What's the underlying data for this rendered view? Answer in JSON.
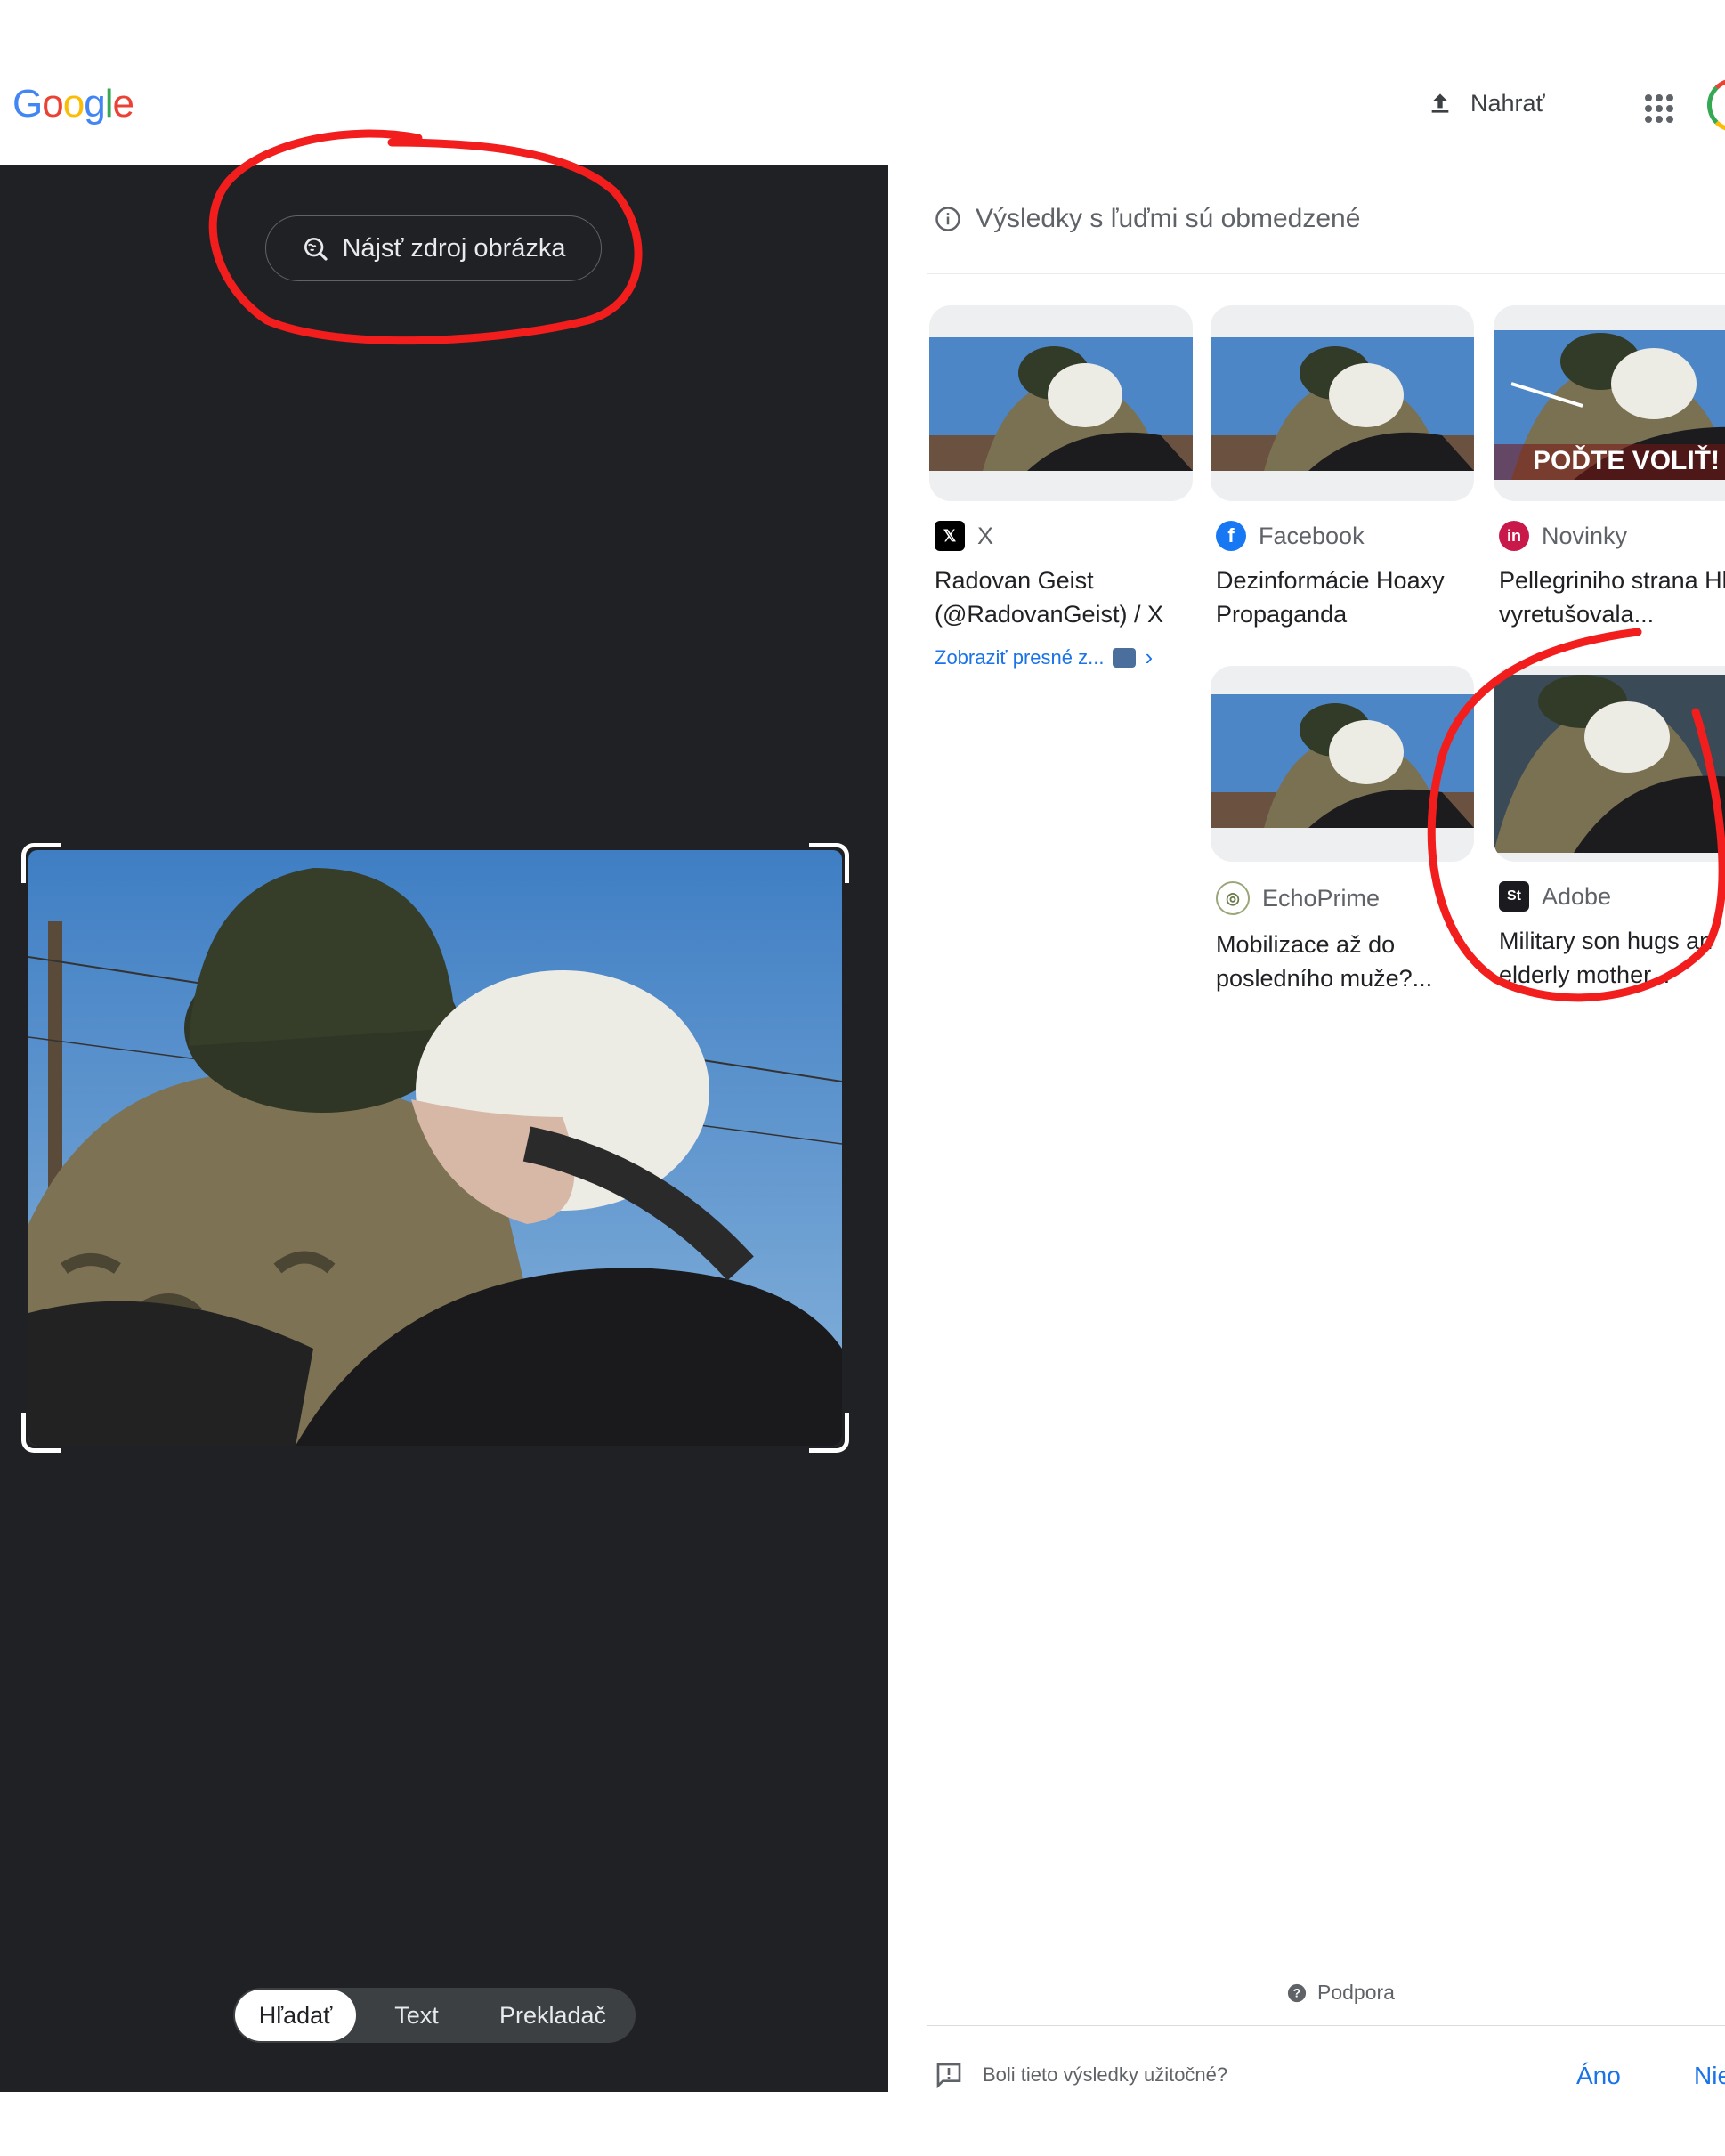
{
  "header": {
    "logo_letters": [
      "G",
      "o",
      "o",
      "g",
      "l",
      "e"
    ],
    "logo_colors": [
      "#4285f4",
      "#ea4335",
      "#fbbc05",
      "#4285f4",
      "#34a853",
      "#ea4335"
    ],
    "upload_label": "Nahrať",
    "upload_icon": "upload-icon",
    "apps_icon": "apps-grid-icon"
  },
  "left_panel": {
    "find_source_label": "Nájsť zdroj obrázka",
    "find_source_icon": "lens-search-icon",
    "tabs": [
      {
        "label": "Hľadať",
        "selected": true
      },
      {
        "label": "Text",
        "selected": false
      },
      {
        "label": "Prekladač",
        "selected": false
      }
    ]
  },
  "results": {
    "notice": "Výsledky s ľuďmi sú obmedzené",
    "notice_icon": "info-icon",
    "cards": [
      {
        "source": "X",
        "favicon": "x-logo-icon",
        "title": "Radovan Geist (@RadovanGeist) / X",
        "exact_match": "Zobraziť presné z...",
        "overlay_text": ""
      },
      {
        "source": "Facebook",
        "favicon": "facebook-icon",
        "title": "Dezinformácie Hoaxy Propaganda",
        "exact_match": "",
        "overlay_text": ""
      },
      {
        "source": "Novinky",
        "favicon": "novinky-icon",
        "title": "Pellegriniho strana Hlas vyretušovala...",
        "exact_match": "",
        "overlay_text": "POĎTE VOLIŤ!"
      },
      {
        "source": "EchoPrime",
        "favicon": "echoprime-icon",
        "title": "Mobilizace až do posledního muže?...",
        "exact_match": "",
        "overlay_text": ""
      },
      {
        "source": "Adobe",
        "favicon": "adobe-stock-icon",
        "title": "Military son hugs an elderly mother...",
        "exact_match": "",
        "overlay_text": ""
      }
    ],
    "support_label": "Podpora",
    "feedback_question": "Boli tieto výsledky užitočné?",
    "yes_label": "Áno",
    "no_label": "Nie"
  },
  "colors": {
    "dark_panel": "#202124",
    "link_blue": "#1a73e8",
    "annotation_red": "#f21d1d"
  }
}
